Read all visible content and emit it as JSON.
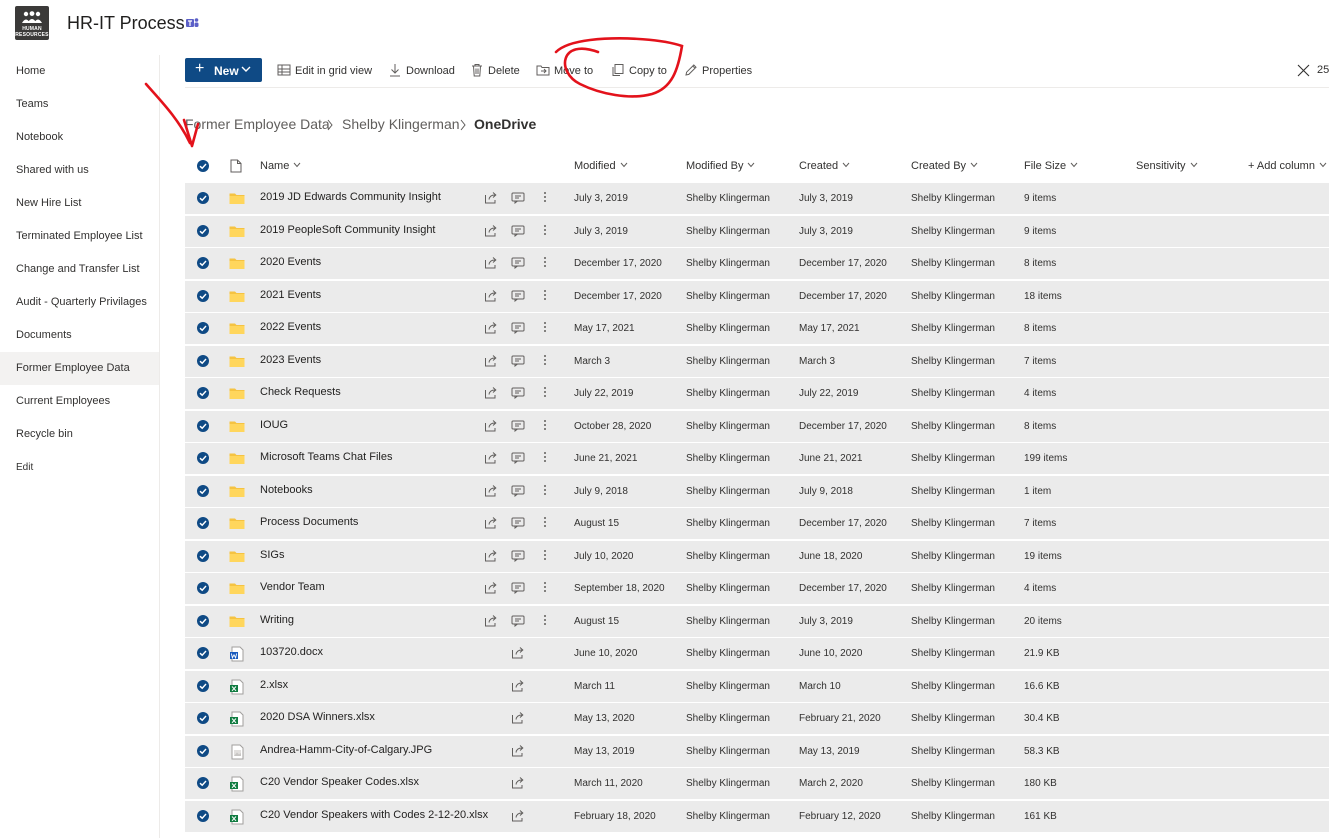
{
  "header": {
    "logo_text": "HUMAN RESOURCES",
    "site_title": "HR-IT Process"
  },
  "nav": {
    "items": [
      {
        "label": "Home"
      },
      {
        "label": "Teams"
      },
      {
        "label": "Notebook"
      },
      {
        "label": "Shared with us"
      },
      {
        "label": "New Hire List"
      },
      {
        "label": "Terminated Employee List"
      },
      {
        "label": "Change and Transfer List"
      },
      {
        "label": "Audit - Quarterly Privilages"
      },
      {
        "label": "Documents"
      },
      {
        "label": "Former Employee Data",
        "selected": true
      },
      {
        "label": "Current Employees"
      },
      {
        "label": "Recycle bin"
      },
      {
        "label": "Edit"
      }
    ]
  },
  "toolbar": {
    "new_label": "New",
    "edit_grid_label": "Edit in grid view",
    "download_label": "Download",
    "delete_label": "Delete",
    "move_label": "Move to",
    "copy_label": "Copy to",
    "properties_label": "Properties",
    "selected_count": "25"
  },
  "breadcrumb": {
    "items": [
      "Former Employee Data",
      "Shelby Klingerman",
      "OneDrive"
    ]
  },
  "columns": {
    "name": "Name",
    "modified": "Modified",
    "modified_by": "Modified By",
    "created": "Created",
    "created_by": "Created By",
    "file_size": "File Size",
    "sensitivity": "Sensitivity",
    "add_column": "+ Add column"
  },
  "rows": [
    {
      "type": "folder",
      "name": "2019 JD Edwards Community Insight",
      "modified": "July 3, 2019",
      "modified_by": "Shelby Klingerman",
      "created": "July 3, 2019",
      "created_by": "Shelby Klingerman",
      "size": "9 items"
    },
    {
      "type": "folder",
      "name": "2019 PeopleSoft Community Insight",
      "modified": "July 3, 2019",
      "modified_by": "Shelby Klingerman",
      "created": "July 3, 2019",
      "created_by": "Shelby Klingerman",
      "size": "9 items"
    },
    {
      "type": "folder",
      "name": "2020 Events",
      "modified": "December 17, 2020",
      "modified_by": "Shelby Klingerman",
      "created": "December 17, 2020",
      "created_by": "Shelby Klingerman",
      "size": "8 items"
    },
    {
      "type": "folder",
      "name": "2021 Events",
      "modified": "December 17, 2020",
      "modified_by": "Shelby Klingerman",
      "created": "December 17, 2020",
      "created_by": "Shelby Klingerman",
      "size": "18 items"
    },
    {
      "type": "folder",
      "name": "2022 Events",
      "modified": "May 17, 2021",
      "modified_by": "Shelby Klingerman",
      "created": "May 17, 2021",
      "created_by": "Shelby Klingerman",
      "size": "8 items"
    },
    {
      "type": "folder",
      "name": "2023 Events",
      "modified": "March 3",
      "modified_by": "Shelby Klingerman",
      "created": "March 3",
      "created_by": "Shelby Klingerman",
      "size": "7 items"
    },
    {
      "type": "folder",
      "name": "Check Requests",
      "modified": "July 22, 2019",
      "modified_by": "Shelby Klingerman",
      "created": "July 22, 2019",
      "created_by": "Shelby Klingerman",
      "size": "4 items"
    },
    {
      "type": "folder",
      "name": "IOUG",
      "modified": "October 28, 2020",
      "modified_by": "Shelby Klingerman",
      "created": "December 17, 2020",
      "created_by": "Shelby Klingerman",
      "size": "8 items"
    },
    {
      "type": "folder",
      "name": "Microsoft Teams Chat Files",
      "modified": "June 21, 2021",
      "modified_by": "Shelby Klingerman",
      "created": "June 21, 2021",
      "created_by": "Shelby Klingerman",
      "size": "199 items"
    },
    {
      "type": "folder",
      "name": "Notebooks",
      "modified": "July 9, 2018",
      "modified_by": "Shelby Klingerman",
      "created": "July 9, 2018",
      "created_by": "Shelby Klingerman",
      "size": "1 item"
    },
    {
      "type": "folder",
      "name": "Process Documents",
      "modified": "August 15",
      "modified_by": "Shelby Klingerman",
      "created": "December 17, 2020",
      "created_by": "Shelby Klingerman",
      "size": "7 items"
    },
    {
      "type": "folder",
      "name": "SIGs",
      "modified": "July 10, 2020",
      "modified_by": "Shelby Klingerman",
      "created": "June 18, 2020",
      "created_by": "Shelby Klingerman",
      "size": "19 items"
    },
    {
      "type": "folder",
      "name": "Vendor Team",
      "modified": "September 18, 2020",
      "modified_by": "Shelby Klingerman",
      "created": "December 17, 2020",
      "created_by": "Shelby Klingerman",
      "size": "4 items"
    },
    {
      "type": "folder",
      "name": "Writing",
      "modified": "August 15",
      "modified_by": "Shelby Klingerman",
      "created": "July 3, 2019",
      "created_by": "Shelby Klingerman",
      "size": "20 items"
    },
    {
      "type": "word",
      "name": "103720.docx",
      "modified": "June 10, 2020",
      "modified_by": "Shelby Klingerman",
      "created": "June 10, 2020",
      "created_by": "Shelby Klingerman",
      "size": "21.9 KB"
    },
    {
      "type": "excel",
      "name": "2.xlsx",
      "modified": "March 11",
      "modified_by": "Shelby Klingerman",
      "created": "March 10",
      "created_by": "Shelby Klingerman",
      "size": "16.6 KB"
    },
    {
      "type": "excel",
      "name": "2020 DSA Winners.xlsx",
      "modified": "May 13, 2020",
      "modified_by": "Shelby Klingerman",
      "created": "February 21, 2020",
      "created_by": "Shelby Klingerman",
      "size": "30.4 KB"
    },
    {
      "type": "image",
      "name": "Andrea-Hamm-City-of-Calgary.JPG",
      "modified": "May 13, 2019",
      "modified_by": "Shelby Klingerman",
      "created": "May 13, 2019",
      "created_by": "Shelby Klingerman",
      "size": "58.3 KB"
    },
    {
      "type": "excel",
      "name": "C20 Vendor Speaker Codes.xlsx",
      "modified": "March 11, 2020",
      "modified_by": "Shelby Klingerman",
      "created": "March 2, 2020",
      "created_by": "Shelby Klingerman",
      "size": "180 KB"
    },
    {
      "type": "excel",
      "name": "C20 Vendor Speakers with Codes 2-12-20.xlsx",
      "modified": "February 18, 2020",
      "modified_by": "Shelby Klingerman",
      "created": "February 12, 2020",
      "created_by": "Shelby Klingerman",
      "size": "161 KB"
    }
  ],
  "colors": {
    "primary": "#0f4a85",
    "row_selected": "#ebebeb",
    "folder": "#f5c342",
    "annotation": "#e3121b"
  }
}
